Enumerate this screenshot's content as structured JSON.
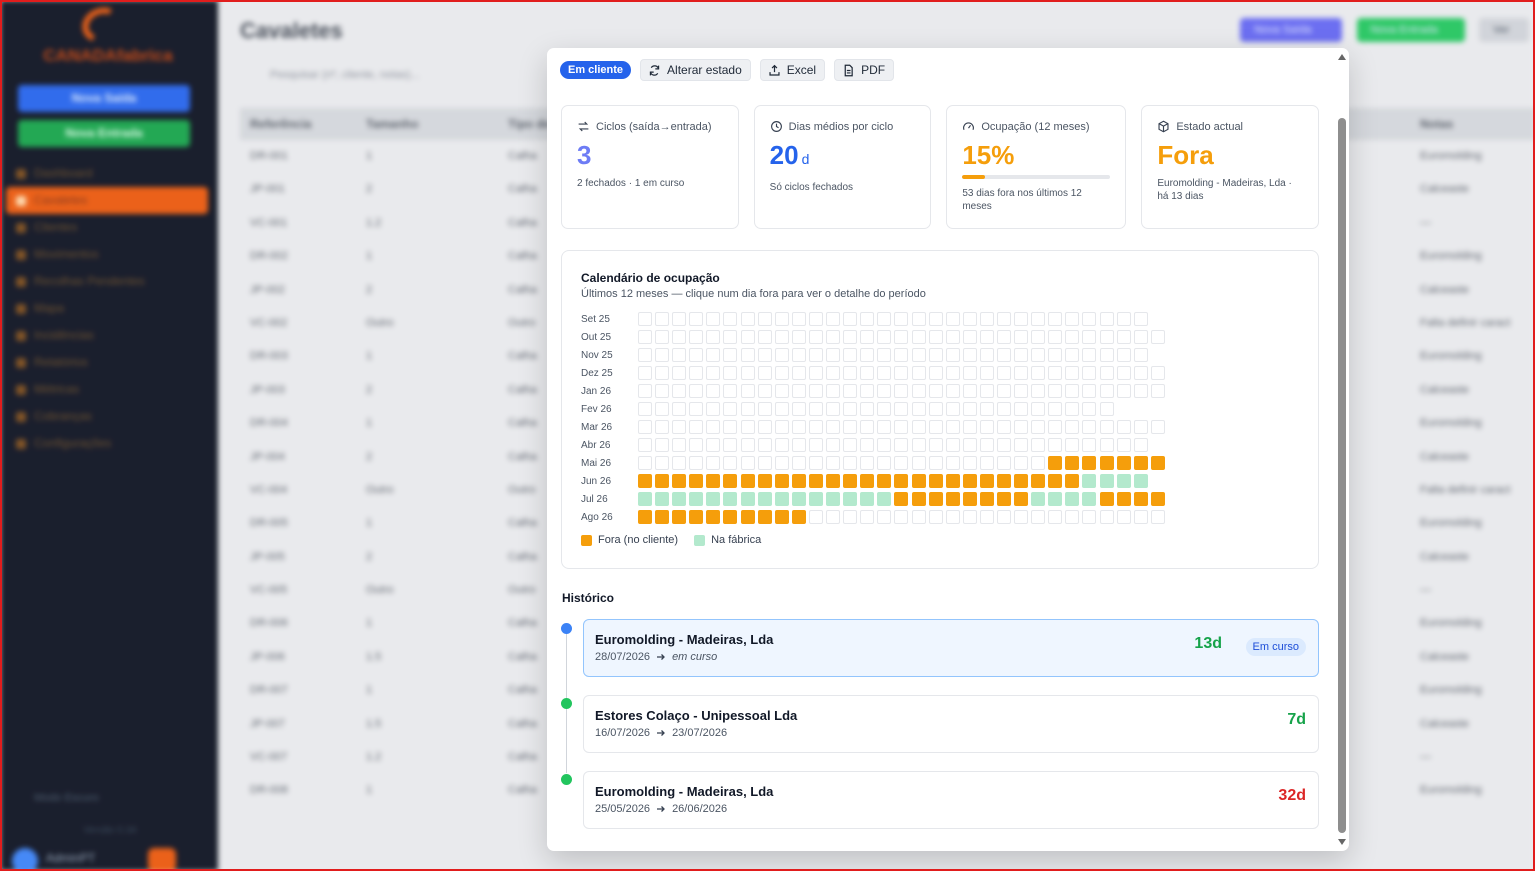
{
  "background": {
    "app_logo_text": "CANADAfabrica",
    "sidebar_buttons": [
      "Nova Saída",
      "Nova Entrada"
    ],
    "sidebar_nav": [
      "Dashboard",
      "Cavaletes",
      "Clientes",
      "Movimentos",
      "Recolhas Pendentes",
      "Mapa",
      "Incidências",
      "Relatórios",
      "Métricas",
      "Cobranças",
      "Configurações"
    ],
    "sidebar_active": "Cavaletes",
    "dark_mode_label": "Modo Escuro",
    "version": "Versão 0.34",
    "user_name": "AdminPT",
    "page_title": "Cavaletes",
    "header_actions": [
      "Nova Saída",
      "Nova Entrada",
      "Ver"
    ],
    "search_placeholder": "Pesquisar (nº, cliente, notas)...",
    "table_headers": [
      "Referência",
      "Tamanho",
      "Tipo de",
      "Notas"
    ],
    "table_rows": [
      [
        "DR-001",
        "1",
        "Calha",
        "Euromolding"
      ],
      [
        "JP-001",
        "2",
        "Calha",
        "Calceaste"
      ],
      [
        "VC-001",
        "1.2",
        "Calha",
        "—"
      ],
      [
        "DR-002",
        "1",
        "Calha",
        "Euromolding"
      ],
      [
        "JP-002",
        "2",
        "Calha",
        "Calceaste"
      ],
      [
        "VC-002",
        "Outro",
        "Outro",
        "Falta definir caract"
      ],
      [
        "DR-003",
        "1",
        "Calha",
        "Euromolding"
      ],
      [
        "JP-003",
        "2",
        "Calha",
        "Calceaste"
      ],
      [
        "DR-004",
        "1",
        "Calha",
        "Euromolding"
      ],
      [
        "JP-004",
        "2",
        "Calha",
        "Calceaste"
      ],
      [
        "VC-004",
        "Outro",
        "Outro",
        "Falta definir caract"
      ],
      [
        "DR-005",
        "1",
        "Calha",
        "Euromolding"
      ],
      [
        "JP-005",
        "2",
        "Calha",
        "Calceaste"
      ],
      [
        "VC-005",
        "Outro",
        "Outro",
        "—"
      ],
      [
        "DR-006",
        "1",
        "Calha",
        "Euromolding"
      ],
      [
        "JP-006",
        "1.5",
        "Calha",
        "Calceaste"
      ],
      [
        "DR-007",
        "1",
        "Calha",
        "Euromolding"
      ],
      [
        "JP-007",
        "1.5",
        "Calha",
        "Calceaste"
      ],
      [
        "VC-007",
        "1.2",
        "Calha",
        "—"
      ],
      [
        "DR-008",
        "1",
        "Calha",
        "Euromolding"
      ]
    ]
  },
  "modal": {
    "status_badge": "Em cliente",
    "status_color": "#2563eb",
    "toolbar": {
      "change_state": "Alterar estado",
      "excel": "Excel",
      "pdf": "PDF"
    },
    "cards": [
      {
        "label": "Ciclos (saída→entrada)",
        "icon": "cycle-icon",
        "value": "3",
        "unit": "",
        "sub": "2 fechados · 1 em curso"
      },
      {
        "label": "Dias médios por ciclo",
        "icon": "clock-icon",
        "value": "20",
        "unit": "d",
        "sub": "Só ciclos fechados"
      },
      {
        "label": "Ocupação (12 meses)",
        "icon": "gauge-icon",
        "value": "15%",
        "unit": "",
        "sub": "53 dias fora nos últimos 12 meses",
        "progress": 0.15
      },
      {
        "label": "Estado actual",
        "icon": "box-icon",
        "value": "Fora",
        "unit": "",
        "sub": "Euromolding - Madeiras, Lda · há 13 dias"
      }
    ],
    "calendar": {
      "title": "Calendário de ocupação",
      "subtitle": "Últimos 12 meses — clique num dia fora para ver o detalhe do período",
      "months": [
        {
          "label": "Set 25",
          "days": 30,
          "out": [],
          "in": []
        },
        {
          "label": "Out 25",
          "days": 31,
          "out": [],
          "in": []
        },
        {
          "label": "Nov 25",
          "days": 30,
          "out": [],
          "in": []
        },
        {
          "label": "Dez 25",
          "days": 31,
          "out": [],
          "in": []
        },
        {
          "label": "Jan 26",
          "days": 31,
          "out": [],
          "in": []
        },
        {
          "label": "Fev 26",
          "days": 28,
          "out": [],
          "in": []
        },
        {
          "label": "Mar 26",
          "days": 31,
          "out": [],
          "in": []
        },
        {
          "label": "Abr 26",
          "days": 30,
          "out": [],
          "in": []
        },
        {
          "label": "Mai 26",
          "days": 31,
          "out": [
            [
              25,
              31
            ]
          ],
          "in": []
        },
        {
          "label": "Jun 26",
          "days": 30,
          "out": [
            [
              1,
              26
            ]
          ],
          "in": [
            [
              27,
              30
            ]
          ]
        },
        {
          "label": "Jul 26",
          "days": 31,
          "out": [
            [
              16,
              23
            ],
            [
              28,
              31
            ]
          ],
          "in": [
            [
              1,
              15
            ],
            [
              24,
              27
            ]
          ]
        },
        {
          "label": "Ago 26",
          "days": 31,
          "out": [
            [
              1,
              10
            ]
          ],
          "in": []
        }
      ],
      "legend_out": "Fora (no cliente)",
      "legend_in": "Na fábrica",
      "color_out": "#f59e0b",
      "color_in": "#b3e9cd"
    },
    "history_title": "Histórico",
    "history": [
      {
        "client": "Euromolding - Madeiras, Lda",
        "start": "28/07/2026",
        "end": "em curso",
        "days": "13d",
        "badge": "Em curso",
        "current": true,
        "days_color": "green"
      },
      {
        "client": "Estores Colaço - Unipessoal Lda",
        "start": "16/07/2026",
        "end": "23/07/2026",
        "days": "7d",
        "badge": "",
        "current": false,
        "days_color": "green"
      },
      {
        "client": "Euromolding - Madeiras, Lda",
        "start": "25/05/2026",
        "end": "26/06/2026",
        "days": "32d",
        "badge": "",
        "current": false,
        "days_color": "red"
      }
    ]
  }
}
